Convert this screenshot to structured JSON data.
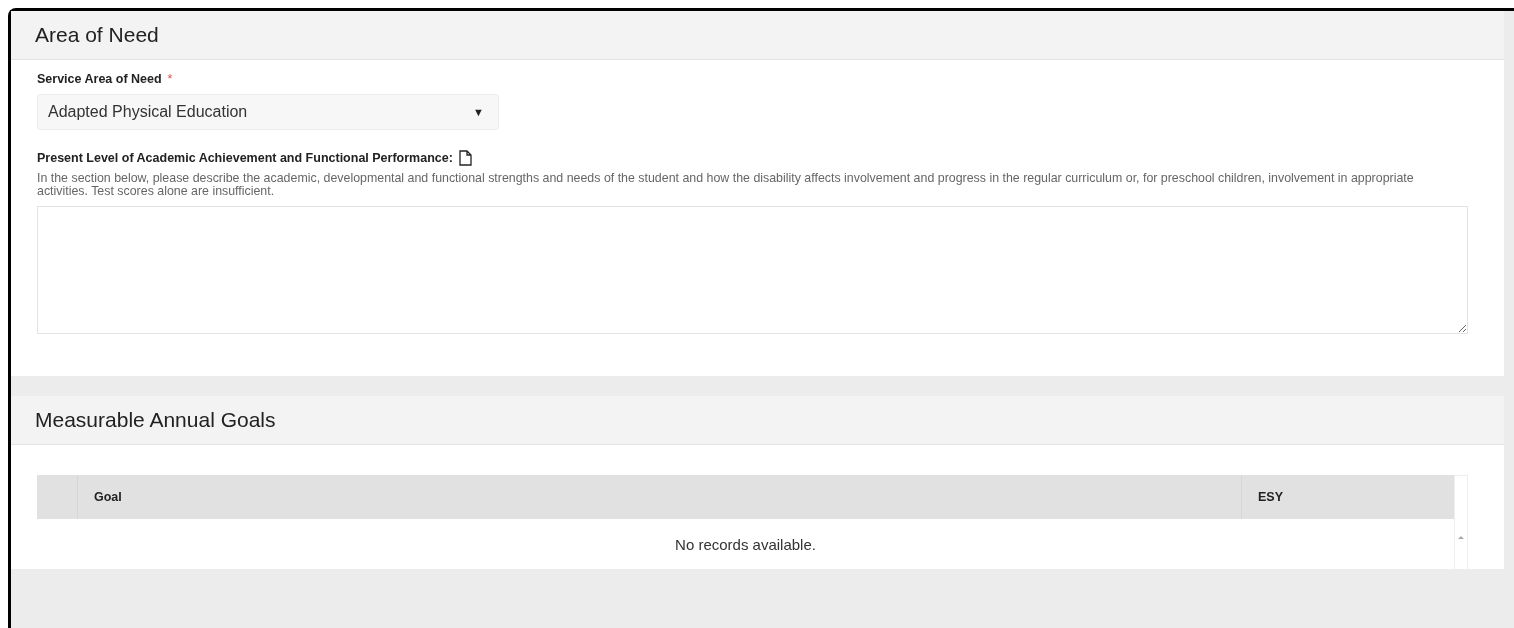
{
  "area_of_need": {
    "title": "Area of Need",
    "service_area": {
      "label": "Service Area of Need",
      "required_mark": "*",
      "value": "Adapted Physical Education",
      "caret": "▼"
    },
    "present_level": {
      "label": "Present Level of Academic Achievement and Functional Performance:",
      "description": "In the section below, please describe the academic, developmental and functional strengths and needs of the student and how the disability affects involvement and progress in the regular curriculum or, for preschool children, involvement in appropriate activities. Test scores alone are insufficient."
    }
  },
  "goals": {
    "title": "Measurable Annual Goals",
    "table": {
      "columns": [
        "Goal",
        "ESY"
      ],
      "empty_message": "No records available."
    }
  }
}
